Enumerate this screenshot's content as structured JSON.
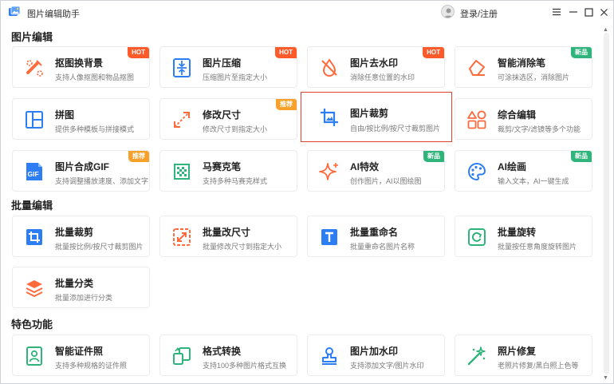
{
  "app": {
    "title": "图片编辑助手"
  },
  "header": {
    "login_label": "登录/注册"
  },
  "sections": {
    "edit": "图片编辑",
    "batch": "批量编辑",
    "feature": "特色功能"
  },
  "badges": {
    "hot": "HOT",
    "recommended": "推荐",
    "new": "新品"
  },
  "tools": {
    "cutout": {
      "name": "抠图换背景",
      "desc": "支持人像抠图和物品抠图"
    },
    "compress": {
      "name": "图片压缩",
      "desc": "压缩图片至指定大小"
    },
    "watermark_remove": {
      "name": "图片去水印",
      "desc": "消除任意位置的水印"
    },
    "eraser": {
      "name": "智能消除笔",
      "desc": "可涂抹选区，消除图片"
    },
    "collage": {
      "name": "拼图",
      "desc": "提供多种模板与拼接模式"
    },
    "resize": {
      "name": "修改尺寸",
      "desc": "修改尺寸到指定大小"
    },
    "crop": {
      "name": "图片裁剪",
      "desc": "自由/按比例/按尺寸裁剪图片"
    },
    "combo": {
      "name": "综合编辑",
      "desc": "裁剪/文字/滤镜等多个功能"
    },
    "gif": {
      "name": "图片合成GIF",
      "desc": "支持调整播放速度、添加文字"
    },
    "mosaic": {
      "name": "马赛克笔",
      "desc": "支持多种马赛克样式"
    },
    "ai_effect": {
      "name": "AI特效",
      "desc": "创作图片，AI以图绘图"
    },
    "ai_paint": {
      "name": "AI绘画",
      "desc": "输入文本，AI一键生成"
    },
    "batch_crop": {
      "name": "批量裁剪",
      "desc": "批量按比例/按尺寸裁剪图片"
    },
    "batch_resize": {
      "name": "批量改尺寸",
      "desc": "批量修改尺寸到指定大小"
    },
    "batch_rename": {
      "name": "批量重命名",
      "desc": "批量重命名图片名称"
    },
    "batch_rotate": {
      "name": "批量旋转",
      "desc": "批量按任意角度旋转图片"
    },
    "batch_classify": {
      "name": "批量分类",
      "desc": "批量添加进行分类"
    },
    "id_photo": {
      "name": "智能证件照",
      "desc": "支持多种规格的证件照"
    },
    "format": {
      "name": "格式转换",
      "desc": "支持100多种图片格式互换"
    },
    "watermark_add": {
      "name": "图片加水印",
      "desc": "支持添加文字/图片水印"
    },
    "restore": {
      "name": "照片修复",
      "desc": "老照片修复/黑白照上色等"
    }
  },
  "icons": {
    "cutout": "cutout-icon",
    "compress": "compress-icon",
    "watermark_remove": "watermark-remove-icon",
    "eraser": "eraser-icon",
    "collage": "collage-icon",
    "resize": "resize-icon",
    "crop": "crop-icon",
    "combo": "shapes-icon",
    "gif": "gif-icon",
    "mosaic": "mosaic-icon",
    "ai_effect": "sparkle-icon",
    "ai_paint": "palette-icon",
    "id_photo": "id-card-icon",
    "format": "convert-icon",
    "watermark_add": "stamp-icon",
    "restore": "magic-wand-icon"
  },
  "colors": {
    "accent_blue": "#2d7df3",
    "accent_orange": "#ff6a3d",
    "accent_green": "#2fb47b",
    "hot_badge": "#ff5a2a",
    "recommended_badge": "#f7a12b",
    "new_badge": "#2fb47b",
    "selected_border": "#e2412f"
  }
}
